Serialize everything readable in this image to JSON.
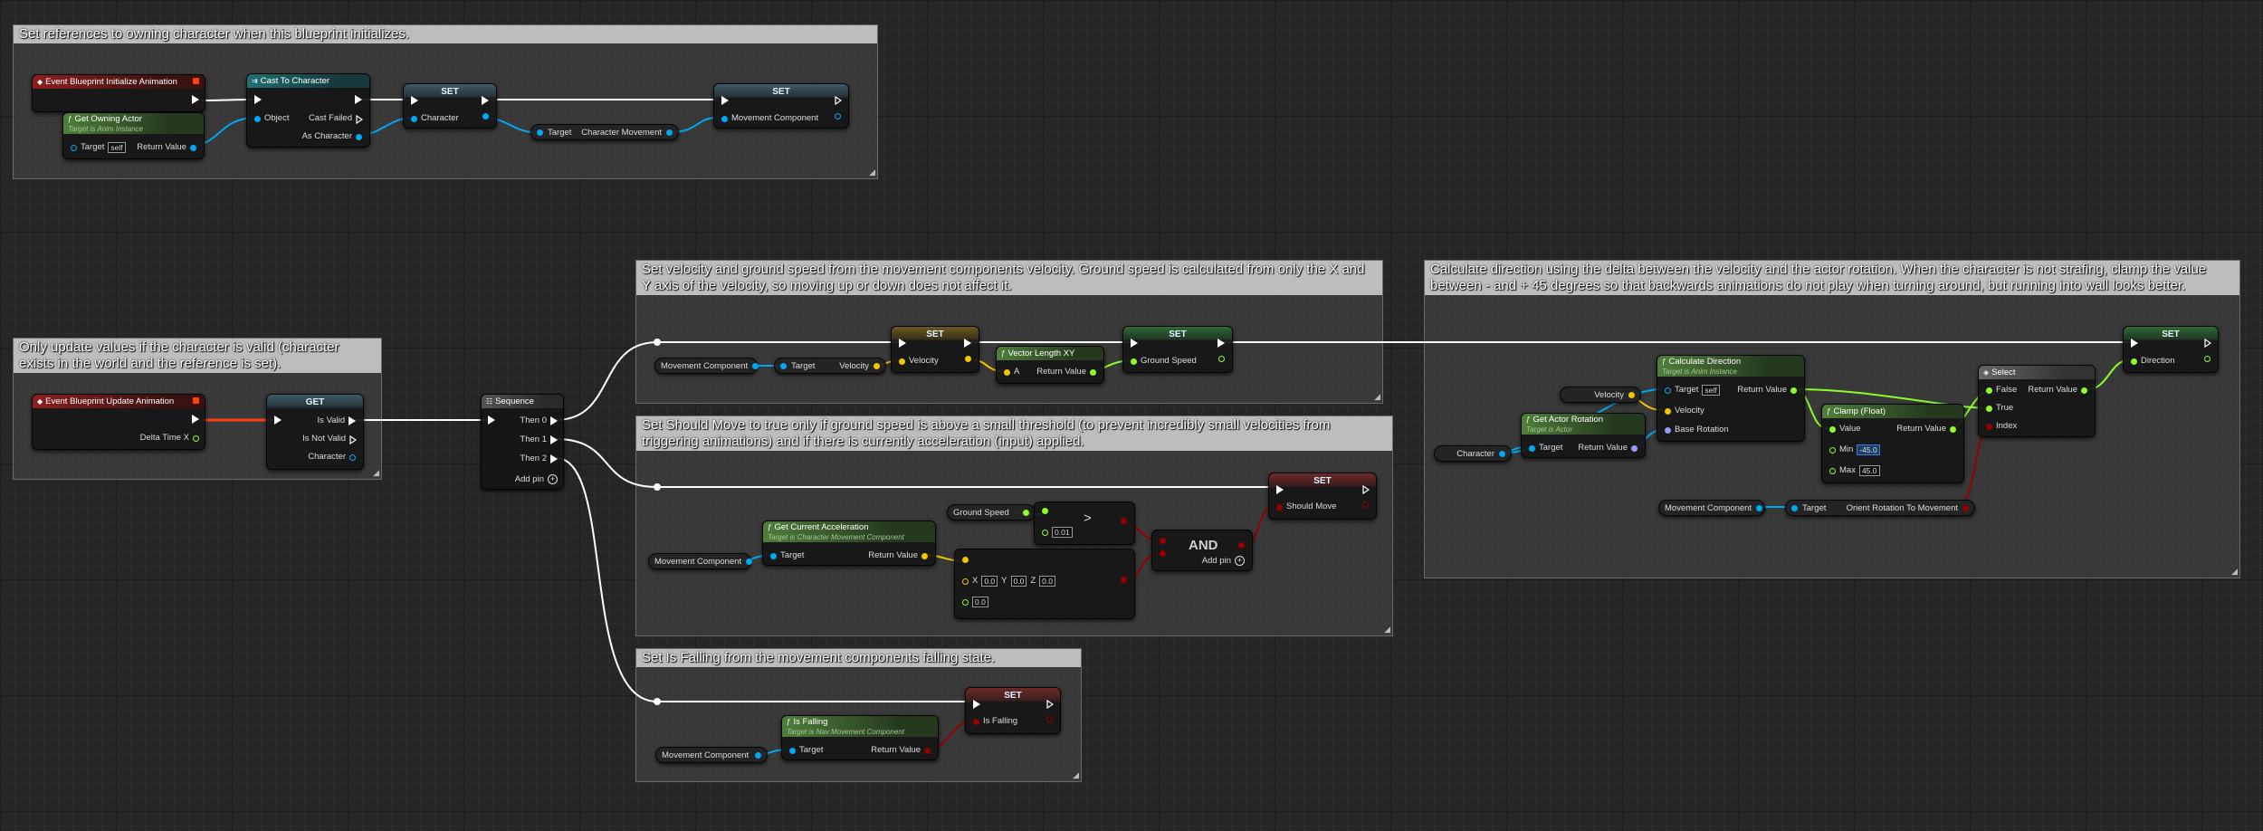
{
  "colors": {
    "exec": "#ffffff",
    "object": "#00a8f4",
    "bool": "#950000",
    "float": "#8cfc2c",
    "vector": "#f2c500",
    "delegate": "#ff4010"
  },
  "comments": {
    "init": "Set references to owning character when this blueprint initializes.",
    "update": "Only update values if the character is valid (character exists in the world and the reference is set).",
    "velocity": "Set velocity and ground speed from the movement components velocity. Ground speed is calculated from only the X and Y axis of the velocity, so moving up or down does not affect it.",
    "should_move": "Set Should Move to true only if ground speed is above a small threshold (to prevent incredibly small velocities from triggering animations) and if there is currently acceleration (input) applied.",
    "falling": "Set Is Falling from the movement components falling state.",
    "direction": "Calculate direction using the delta between the velocity and the actor rotation. When the character is not strafing, clamp the value between - and + 45 degrees so that backwards animations do not play when turning around, but running into wall looks better."
  },
  "init": {
    "event_title": "Event Blueprint Initialize Animation",
    "get_owner_title": "Get Owning Actor",
    "get_owner_sub": "Target is Anim Instance",
    "target": "Target",
    "self": "self",
    "return_value": "Return Value",
    "cast_title": "Cast To Character",
    "object": "Object",
    "cast_failed": "Cast Failed",
    "as_character": "As Character",
    "set": "SET",
    "character": "Character",
    "char_move": "Character Movement",
    "movement_component": "Movement Component"
  },
  "update": {
    "event_title": "Event Blueprint Update Animation",
    "delta": "Delta Time X",
    "get": "GET",
    "is_valid": "Is Valid",
    "is_not_valid": "Is Not Valid",
    "character": "Character",
    "sequence": "Sequence",
    "then0": "Then 0",
    "then1": "Then 1",
    "then2": "Then 2",
    "add_pin": "Add pin"
  },
  "velocity": {
    "movement_component": "Movement Component",
    "target": "Target",
    "velocity": "Velocity",
    "set": "SET",
    "vlen_title": "Vector Length XY",
    "a": "A",
    "return_value": "Return Value",
    "ground_speed": "Ground Speed"
  },
  "should": {
    "movement_component": "Movement Component",
    "accel_title": "Get Current Acceleration",
    "accel_sub": "Target is Character Movement Component",
    "target": "Target",
    "return_value": "Return Value",
    "ground_speed": "Ground Speed",
    "threshold": "0.01",
    "x": "X",
    "y": "Y",
    "z": "Z",
    "xv": "0.0",
    "yv": "0.0",
    "zv": "0.0",
    "tol": "0.0",
    "and": "AND",
    "add_pin": "Add pin",
    "set": "SET",
    "should_move": "Should Move"
  },
  "falling": {
    "movement_component": "Movement Component",
    "title": "Is Falling",
    "sub": "Target is Nav Movement Component",
    "target": "Target",
    "return_value": "Return Value",
    "set": "SET",
    "is_falling": "Is Falling"
  },
  "direction": {
    "velocity": "Velocity",
    "character": "Character",
    "rot_title": "Get Actor Rotation",
    "rot_sub": "Target is Actor",
    "target": "Target",
    "return_value": "Return Value",
    "calc_title": "Calculate Direction",
    "calc_sub": "Target is Anim Instance",
    "self": "self",
    "base_rot": "Base Rotation",
    "clamp_title": "Clamp (Float)",
    "value": "Value",
    "min": "Min",
    "max": "Max",
    "min_v": "-45.0",
    "max_v": "45.0",
    "select_title": "Select",
    "false": "False",
    "true": "True",
    "index": "Index",
    "movement_component": "Movement Component",
    "orient": "Orient Rotation To Movement",
    "set": "SET",
    "dir": "Direction"
  }
}
